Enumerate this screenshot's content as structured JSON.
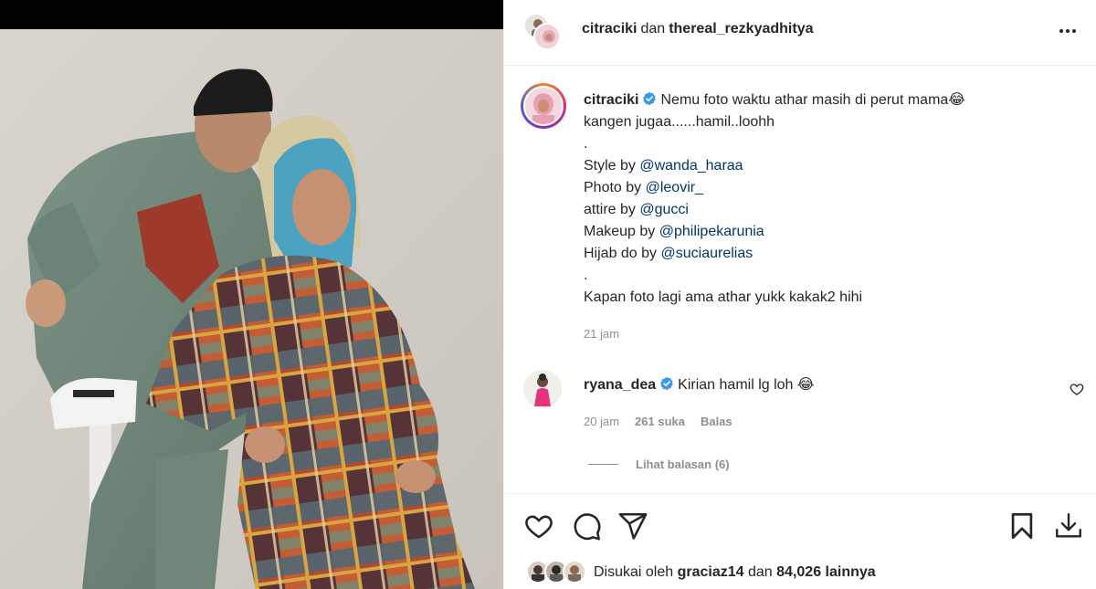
{
  "header": {
    "user1": "citraciki",
    "conjunction": "dan",
    "user2": "thereal_rezkyadhitya",
    "more_icon": "more-horizontal-icon"
  },
  "caption": {
    "username": "citraciki",
    "lines": [
      "Nemu foto waktu athar masih di perut mama😂",
      "kangen jugaa......hamil..loohh",
      ".",
      "Style by ",
      "Photo by ",
      "attire by ",
      "Makeup by ",
      "Hijab do by ",
      ".",
      "Kapan foto lagi ama athar yukk kakak2 hihi"
    ],
    "mentions": {
      "style": "@wanda_haraa",
      "photo": "@leovir_",
      "attire": "@gucci",
      "makeup": "@philipekarunia",
      "hijab": "@suciaurelias"
    },
    "time": "21 jam"
  },
  "comment": {
    "username": "ryana_dea",
    "text": "Kirian hamil lg loh 😂",
    "time": "20 jam",
    "likes": "261 suka",
    "reply_label": "Balas",
    "view_replies": "Lihat balasan (6)"
  },
  "actions": {
    "like": "heart-icon",
    "comment": "comment-icon",
    "share": "share-icon",
    "save": "bookmark-icon",
    "download": "download-icon"
  },
  "likes": {
    "prefix": "Disukai oleh",
    "user": "graciaz14",
    "conjunction": "dan",
    "count": "84,026",
    "suffix": "lainnya"
  },
  "colors": {
    "link": "#00376b",
    "secondary_text": "#8e8e8e",
    "verified": "#3897f0"
  }
}
